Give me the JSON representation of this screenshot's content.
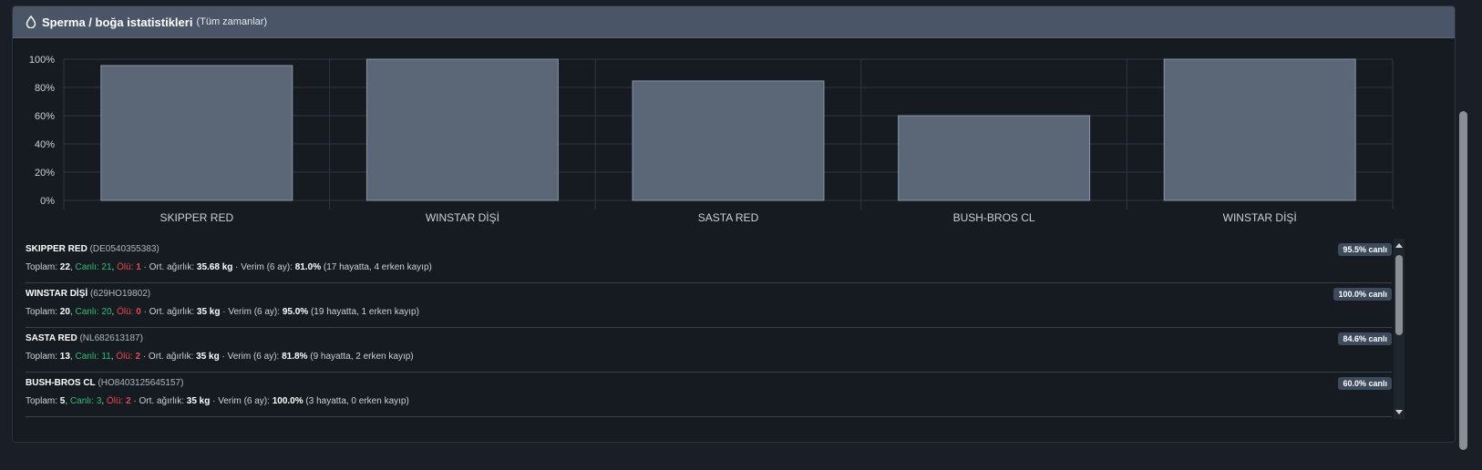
{
  "header": {
    "title": "Sperma / boğa istatistikleri",
    "subtitle": "(Tüm zamanlar)"
  },
  "chart_data": {
    "type": "bar",
    "categories": [
      "SKIPPER RED",
      "WINSTAR DİŞİ",
      "SASTA RED",
      "BUSH-BROS CL",
      "WINSTAR DİŞİ"
    ],
    "values": [
      95.5,
      100.0,
      84.6,
      60.0,
      100.0
    ],
    "ylim": [
      0,
      100
    ],
    "yticks": [
      "0%",
      "20%",
      "40%",
      "60%",
      "80%",
      "100%"
    ],
    "grid": true,
    "bar_color": "#5b6676",
    "bar_border": "#8b95a3"
  },
  "labels": {
    "total": "Toplam:",
    "alive": "Canlı:",
    "dead": "Ölü:",
    "avg_weight": "Ort. ağırlık:",
    "yield": "Verim (6 ay):"
  },
  "bulls": [
    {
      "name": "SKIPPER RED",
      "code": "(DE0540355383)",
      "badge": "95.5% canlı",
      "total": "22",
      "alive": "21",
      "dead": "1",
      "weight": "35.68 kg",
      "yield": "81.0%",
      "detail": "(17 hayatta, 4 erken kayıp)"
    },
    {
      "name": "WINSTAR DİŞİ",
      "code": "(629HO19802)",
      "badge": "100.0% canlı",
      "total": "20",
      "alive": "20",
      "dead": "0",
      "weight": "35 kg",
      "yield": "95.0%",
      "detail": "(19 hayatta, 1 erken kayıp)"
    },
    {
      "name": "SASTA RED",
      "code": "(NL682613187)",
      "badge": "84.6% canlı",
      "total": "13",
      "alive": "11",
      "dead": "2",
      "weight": "35 kg",
      "yield": "81.8%",
      "detail": "(9 hayatta, 2 erken kayıp)"
    },
    {
      "name": "BUSH-BROS CL",
      "code": "(HO8403125645157)",
      "badge": "60.0% canlı",
      "total": "5",
      "alive": "3",
      "dead": "2",
      "weight": "35 kg",
      "yield": "100.0%",
      "detail": "(3 hayatta, 0 erken kayıp)"
    }
  ]
}
